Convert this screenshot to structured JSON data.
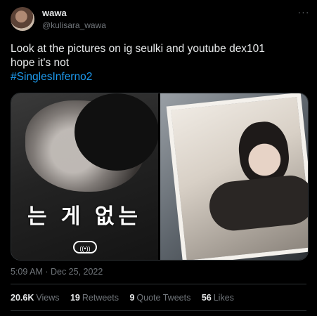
{
  "tweet": {
    "author_name": "wawa",
    "author_handle": "@kulisara_wawa",
    "text_line1": "Look at the pictures on ig seulki and youtube dex101",
    "text_line2": "hope it's not",
    "hashtag": "#SinglesInferno2",
    "timestamp": "5:09 AM · Dec 25, 2022",
    "more_icon": "···"
  },
  "media": {
    "left_caption": "는 게 없는",
    "left_icon_label": "((•))"
  },
  "stats": {
    "views_count": "20.6K",
    "views_label": "Views",
    "retweets_count": "19",
    "retweets_label": "Retweets",
    "quotes_count": "9",
    "quotes_label": "Quote Tweets",
    "likes_count": "56",
    "likes_label": "Likes"
  }
}
